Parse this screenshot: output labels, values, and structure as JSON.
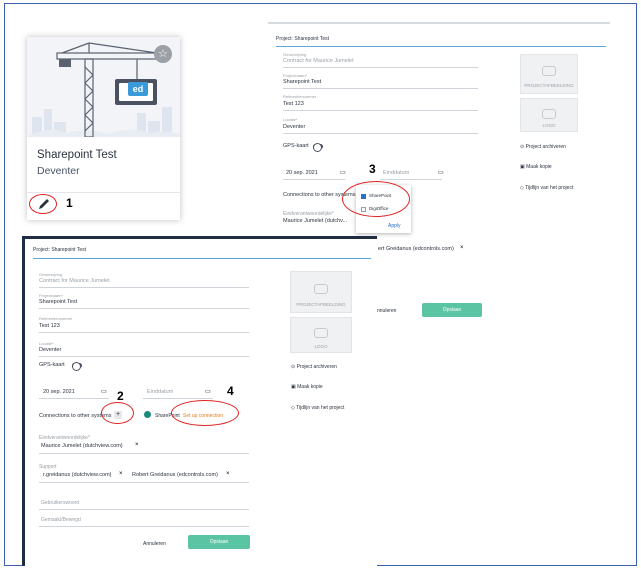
{
  "card": {
    "title": "Sharepoint Test",
    "subtitle": "Deventer",
    "logo_text": "ed"
  },
  "annotations": [
    "1",
    "2",
    "3",
    "4"
  ],
  "top_form": {
    "project_title": "Project: Sharepoint Test",
    "field1_label": "Omschrijving",
    "field1_value": "Contract for Maurice Jumelet",
    "field2_label": "Projectnaam*",
    "field2_value": "Sharepoint Test",
    "field3_label": "Referentienummer",
    "field3_value": "Test 123",
    "field4_label": "Locatie*",
    "field4_value": "Deventer",
    "gps_label": "GPS-kaart",
    "start_date": "20 sep. 2021",
    "end_date_placeholder": "Einddatum",
    "connections_label": "Connections to other systems",
    "responsible_label": "Eindverantwoordelijke*",
    "responsible_value": "Maurice Jumelet (dutchv...",
    "dropdown": {
      "opt1": "SharePoint",
      "opt2": "DigiOffice",
      "apply": "Apply"
    },
    "support_chip": "ert Greidanus (edcontrols.com)",
    "img1_label": "PROJECTAFBEELDING",
    "img2_label": "LOGO",
    "action1": "Project archiveren",
    "action2": "Maak kopie",
    "action3": "Tijdlijn van het project",
    "cancel": "nnuleren",
    "save": "Opslaan"
  },
  "bottom_form": {
    "project_title": "Project: Sharepoint Test",
    "field1_label": "Omschrijving",
    "field1_value": "Contract for Maurice Jumelet",
    "field2_label": "Projectnaam*",
    "field2_value": "Sharepoint Test",
    "field3_label": "Referentienummer",
    "field3_value": "Test 123",
    "field4_label": "Locatie*",
    "field4_value": "Deventer",
    "gps_label": "GPS-kaart",
    "start_date": "20 sep. 2021",
    "end_date_placeholder": "Einddatum",
    "connections_label": "Connections to other systems",
    "plus": "+",
    "sharepoint_label": "SharePoint",
    "setup_link": "Set up connection",
    "responsible_label": "Eindverantwoordelijke*",
    "responsible_value": "Maurice Jumelet (dutchview.com)",
    "support_label": "Support",
    "support_chip1": "r.greidanus (dutchview.com)",
    "support_chip2": "Robert Greidanus (edcontrols.com)",
    "field_gebruikt": "Gebruikerswoord",
    "field_gemaakt": "Gemaakt/Bewegd",
    "img1_label": "PROJECTAFBEELDING",
    "img2_label": "LOGO",
    "action1": "Project archiveren",
    "action2": "Maak kopie",
    "action3": "Tijdlijn van het project",
    "cancel": "Annuleren",
    "save": "Opslaan"
  },
  "colors": {
    "accent_green": "#5bc4a3",
    "annotation_red": "#e02020",
    "frame_blue": "#3a5fb0",
    "link_orange": "#e67e22"
  }
}
